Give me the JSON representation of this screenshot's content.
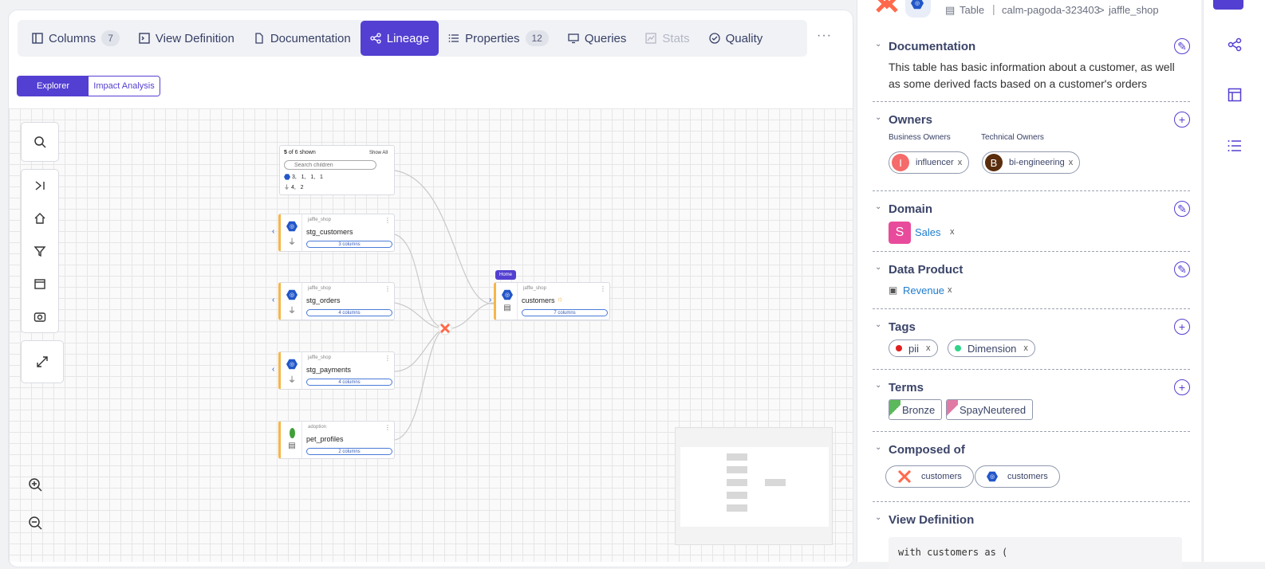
{
  "tabs": [
    {
      "label": "Columns",
      "badge": "7",
      "icon": "columns-icon"
    },
    {
      "label": "View Definition",
      "icon": "terminal-icon"
    },
    {
      "label": "Documentation",
      "icon": "file-icon"
    },
    {
      "label": "Lineage",
      "icon": "lineage-icon",
      "active": true
    },
    {
      "label": "Properties",
      "badge": "12",
      "icon": "list-icon"
    },
    {
      "label": "Queries",
      "icon": "monitor-icon"
    },
    {
      "label": "Stats",
      "icon": "chart-icon",
      "disabled": true
    },
    {
      "label": "Quality",
      "icon": "check-circle-icon"
    }
  ],
  "more_label": "···",
  "toggle": {
    "explorer": "Explorer",
    "impact": "Impact Analysis"
  },
  "lineage": {
    "summary": {
      "count": "5",
      "of_text": "of 6 shown",
      "show_all": "Show All",
      "search_placeholder": "Search children",
      "counts_line1": "3,   1,   1,   1",
      "counts_line2": "4,   2"
    },
    "nodes": [
      {
        "platform": "jaffle_shop",
        "name": "stg_customers",
        "columns": "3 columns"
      },
      {
        "platform": "jaffle_shop",
        "name": "stg_orders",
        "columns": "4 columns"
      },
      {
        "platform": "jaffle_shop",
        "name": "stg_payments",
        "columns": "4 columns"
      },
      {
        "platform": "adoption",
        "name": "pet_profiles",
        "columns": "2 columns"
      }
    ],
    "home": {
      "badge": "Home",
      "platform": "jaffle_shop",
      "name": "customers",
      "columns": "7 columns"
    }
  },
  "header": {
    "type": "Table",
    "path1": "calm-pagoda-323403",
    "sep": ">",
    "path2": "jaffle_shop"
  },
  "documentation": {
    "title": "Documentation",
    "text": "This table has basic information about a customer, as well as some derived facts based on a customer's orders"
  },
  "owners": {
    "title": "Owners",
    "business_label": "Business Owners",
    "technical_label": "Technical Owners",
    "business": {
      "initial": "I",
      "name": "influencer",
      "color": "#f56a6a"
    },
    "technical": {
      "initial": "B",
      "name": "bi-engineering",
      "color": "#5a2d0c"
    }
  },
  "domain": {
    "title": "Domain",
    "initial": "S",
    "name": "Sales",
    "color": "#e84b9b"
  },
  "data_product": {
    "title": "Data Product",
    "name": "Revenue"
  },
  "tags": {
    "title": "Tags",
    "items": [
      {
        "name": "pii",
        "color": "#e01e1e"
      },
      {
        "name": "Dimension",
        "color": "#2fd48a"
      }
    ]
  },
  "terms": {
    "title": "Terms",
    "items": [
      {
        "name": "Bronze",
        "color": "#5cb85c"
      },
      {
        "name": "SpayNeutered",
        "color": "#e07aa5"
      }
    ]
  },
  "composed_of": {
    "title": "Composed of",
    "items": [
      {
        "name": "customers",
        "icon": "dbt-icon"
      },
      {
        "name": "customers",
        "icon": "bigquery-icon"
      }
    ]
  },
  "view_definition": {
    "title": "View Definition",
    "code": "with customers as ("
  },
  "colors": {
    "accent": "#533fd1",
    "node_border": "#f5b64a"
  }
}
